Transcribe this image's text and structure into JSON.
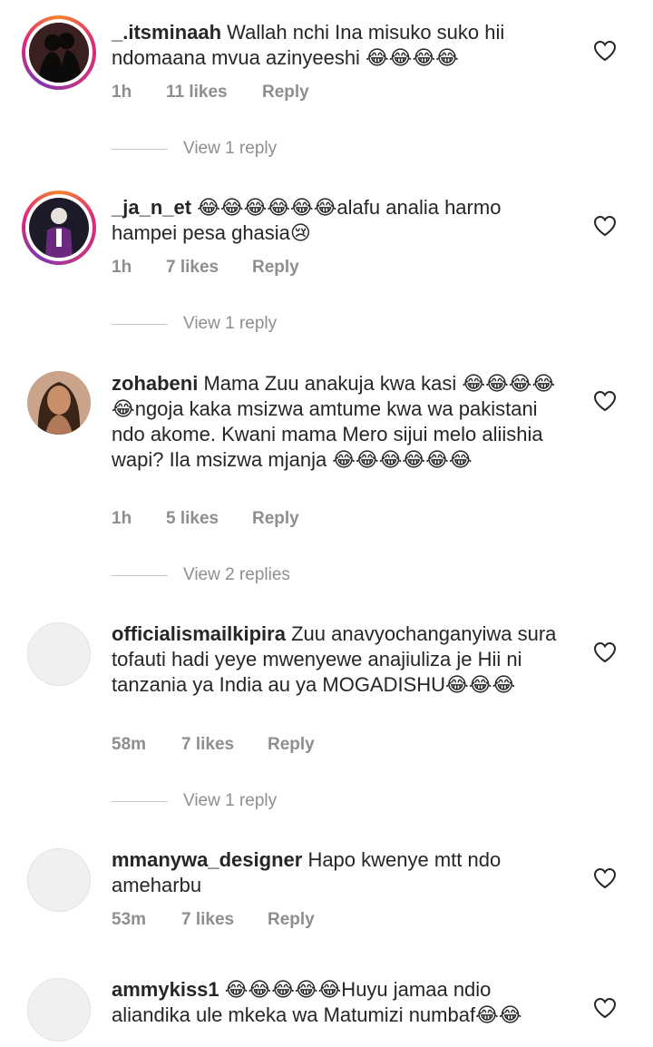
{
  "comments": [
    {
      "username": "_.itsminaah",
      "text": "Wallah nchi Ina misuko suko hii ndomaana mvua azinyeeshi 😂😂😂😂",
      "time": "1h",
      "likes": "11 likes",
      "reply": "Reply",
      "view_replies": "View 1 reply",
      "avatar": "dark-silhouette-couple-avatar"
    },
    {
      "username": "_ja_n_et",
      "text": "😂😂😂😂😂😂alafu analia harmo hampei pesa ghasia😢",
      "time": "1h",
      "likes": "7 likes",
      "reply": "Reply",
      "view_replies": "View 1 reply",
      "avatar": "man-purple-suit-avatar"
    },
    {
      "username": "zohabeni",
      "text": "Mama Zuu anakuja kwa kasi 😂😂😂😂😂ngoja kaka msizwa amtume kwa wa pakistani ndo akome. Kwani mama Mero sijui melo aliishia wapi? Ila msizwa mjanja 😂😂😂😂😂😂",
      "time": "1h",
      "likes": "5 likes",
      "reply": "Reply",
      "view_replies": "View 2 replies",
      "avatar": "woman-portrait-avatar"
    },
    {
      "username": "officialismailkipira",
      "text": "Zuu anavyochanganyiwa sura tofauti hadi yeye mwenyewe anajiuliza je Hii ni tanzania ya India au ya MOGADISHU😂😂😂",
      "time": "58m",
      "likes": "7 likes",
      "reply": "Reply",
      "view_replies": "View 1 reply",
      "avatar": "default-avatar"
    },
    {
      "username": "mmanywa_designer",
      "text": "Hapo kwenye  mtt ndo ameharbu",
      "time": "53m",
      "likes": "7 likes",
      "reply": "Reply",
      "avatar": "default-avatar"
    },
    {
      "username": "ammykiss1",
      "text": "😂😂😂😂😂Huyu jamaa ndio aliandika ule mkeka wa Matumizi numbaf😂😂",
      "avatar": "default-avatar"
    }
  ],
  "icons": {
    "like": "heart-outline-icon"
  },
  "colors": {
    "username": "#262626",
    "meta": "#8e8e8e",
    "story_ring_start": "#f58529",
    "story_ring_end": "#dd2a7b"
  }
}
